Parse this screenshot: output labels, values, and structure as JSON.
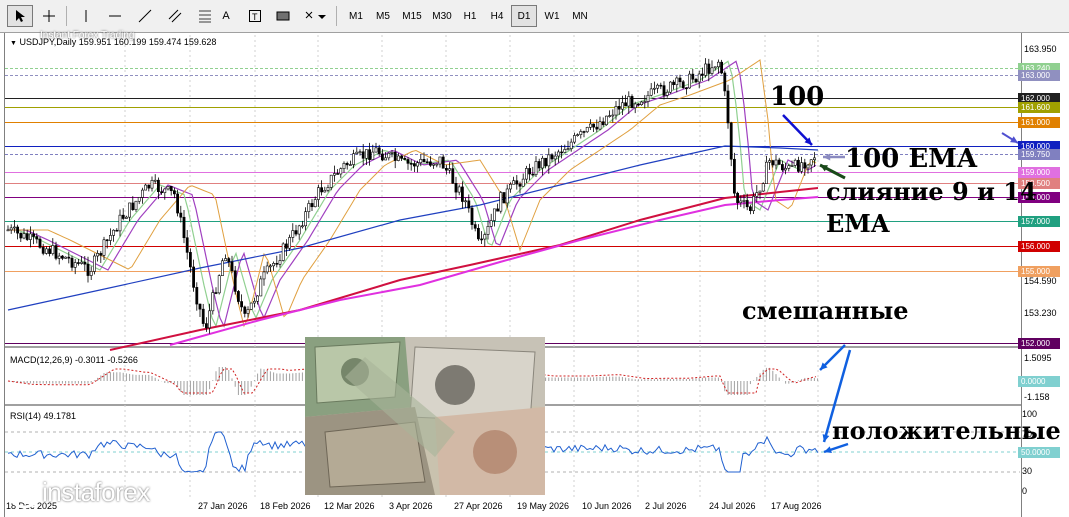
{
  "toolbar": {
    "timeframes": [
      "M1",
      "M5",
      "M15",
      "M30",
      "H1",
      "H4",
      "D1",
      "W1",
      "MN"
    ],
    "active_timeframe": "D1",
    "text_tool": "A"
  },
  "chart": {
    "header": "USDJPY,Daily  159.951 160.199 159.474 159.628",
    "price_axis": [
      "163.950",
      "154.590",
      "153.230"
    ],
    "dates": [
      "27 Jan 2026",
      "18 Feb 2026",
      "12 Mar 2026",
      "3 Apr 2026",
      "27 Apr 2026",
      "19 May 2026",
      "10 Jun 2026",
      "2 Jul 2026",
      "24 Jul 2026",
      "17 Aug 2026"
    ],
    "date_partial": "18 Dec 2025",
    "levels": [
      {
        "label": "163.240",
        "color": "#90d090"
      },
      {
        "label": "163.000",
        "color": "#9090c0"
      },
      {
        "label": "162.000",
        "color": "#202020"
      },
      {
        "label": "161.600",
        "color": "#a0a000"
      },
      {
        "label": "161.000",
        "color": "#e08000"
      },
      {
        "label": "160.000",
        "color": "#1020c0"
      },
      {
        "label": "159.750",
        "color": "#8080c0"
      },
      {
        "label": "159.000",
        "color": "#e070e0"
      },
      {
        "label": "158.500",
        "color": "#e08080"
      },
      {
        "label": "158.000",
        "color": "#800080"
      },
      {
        "label": "157.000",
        "color": "#20a080"
      },
      {
        "label": "156.000",
        "color": "#d00000"
      },
      {
        "label": "155.000",
        "color": "#f0a060"
      },
      {
        "label": "152.000",
        "color": "#600060"
      }
    ]
  },
  "macd": {
    "header": "MACD(12,26,9) -0.3011 -0.5266",
    "axis": [
      "1.5095",
      "0.0000",
      "-1.158"
    ]
  },
  "rsi": {
    "header": "RSI(14) 49.1781",
    "axis": [
      "100",
      "70",
      "50.0000",
      "30",
      "0"
    ]
  },
  "annotations": {
    "n100": "100",
    "ema100": "100 EMA",
    "merge_line1": "слияние 9 и 14",
    "merge_line2": "EMA",
    "mixed": "смешанные",
    "positive": "положительные"
  },
  "branding": {
    "logo": "instaforex",
    "tagline": "Instant Forex Trading"
  },
  "colors": {
    "annotation_blue": "#1060e0",
    "annotation_navy": "#1010d0",
    "annotation_grey": "#8a8ac0",
    "annotation_green": "#1a4a1a"
  }
}
